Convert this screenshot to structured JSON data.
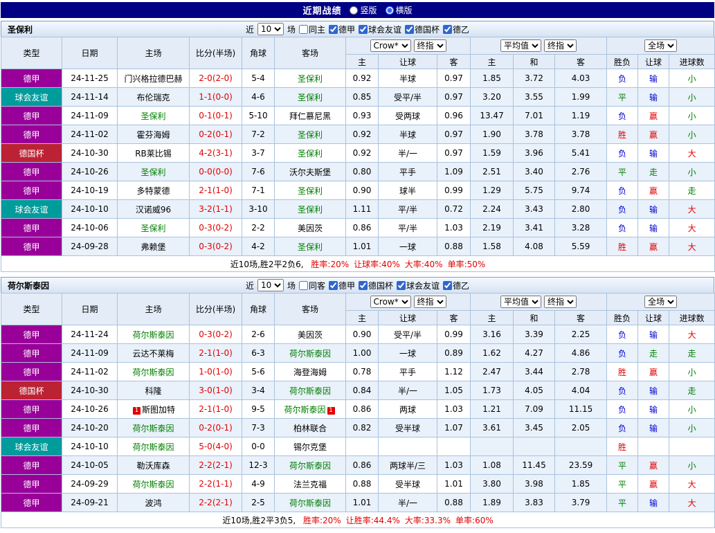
{
  "topbar": {
    "title": "近期战绩",
    "vertical_label": "竖版",
    "horizontal_label": "横版",
    "selected": "横版"
  },
  "colors": {
    "topbar_bg": "#000085",
    "type_bg": {
      "德甲": "#990099",
      "球会友谊": "#009b9b",
      "德国杯": "#bb2233"
    },
    "result_text": {
      "胜": "#e10000",
      "平": "#008000",
      "负": "#0000d0",
      "赢": "#e10000",
      "输": "#0000d0",
      "走": "#008000",
      "大": "#e10000",
      "小": "#008000"
    },
    "score_text": "#e10000",
    "subject_team_text": "#008000",
    "footer_stat_text": "#e10000",
    "redcard_bg": "#e10000"
  },
  "table_header": {
    "static_cols": [
      "类型",
      "日期",
      "主场",
      "比分(半场)",
      "角球",
      "客场"
    ],
    "groups": [
      {
        "selects": [
          "Crow*",
          "终指"
        ],
        "cols": [
          "主",
          "让球",
          "客"
        ],
        "avg": false
      },
      {
        "selects": [
          "平均值",
          "终指"
        ],
        "cols": [
          "主",
          "和",
          "客"
        ],
        "avg": true
      },
      {
        "selects": [
          "全场"
        ],
        "cols": [
          "胜负",
          "让球",
          "进球数"
        ],
        "avg": false
      }
    ]
  },
  "sections": [
    {
      "team": "圣保利",
      "filters": {
        "near_label": "近",
        "count": "10",
        "unit_label": "场",
        "same_label": "同主",
        "same_checked": false,
        "leagues": [
          "德甲",
          "球会友谊",
          "德国杯",
          "德乙"
        ]
      },
      "rows": [
        {
          "type": "德甲",
          "date": "24-11-25",
          "home": "门兴格拉德巴赫",
          "score": "2-0(2-0)",
          "corners": "5-4",
          "away": "圣保利",
          "away_subject": true,
          "odds": [
            "0.92",
            "半球",
            "0.97"
          ],
          "avg": [
            "1.85",
            "3.72",
            "4.03"
          ],
          "results": [
            "负",
            "输",
            "小"
          ]
        },
        {
          "type": "球会友谊",
          "date": "24-11-14",
          "home": "布伦瑞克",
          "score": "1-1(0-0)",
          "corners": "4-6",
          "away": "圣保利",
          "away_subject": true,
          "odds": [
            "0.85",
            "受平/半",
            "0.97"
          ],
          "avg": [
            "3.20",
            "3.55",
            "1.99"
          ],
          "results": [
            "平",
            "输",
            "小"
          ]
        },
        {
          "type": "德甲",
          "date": "24-11-09",
          "home": "圣保利",
          "home_subject": true,
          "score": "0-1(0-1)",
          "corners": "5-10",
          "away": "拜仁慕尼黑",
          "odds": [
            "0.93",
            "受两球",
            "0.96"
          ],
          "avg": [
            "13.47",
            "7.01",
            "1.19"
          ],
          "results": [
            "负",
            "赢",
            "小"
          ]
        },
        {
          "type": "德甲",
          "date": "24-11-02",
          "home": "霍芬海姆",
          "score": "0-2(0-1)",
          "corners": "7-2",
          "away": "圣保利",
          "away_subject": true,
          "odds": [
            "0.92",
            "半球",
            "0.97"
          ],
          "avg": [
            "1.90",
            "3.78",
            "3.78"
          ],
          "results": [
            "胜",
            "赢",
            "小"
          ]
        },
        {
          "type": "德国杯",
          "date": "24-10-30",
          "home": "RB莱比锡",
          "score": "4-2(3-1)",
          "corners": "3-7",
          "away": "圣保利",
          "away_subject": true,
          "odds": [
            "0.92",
            "半/一",
            "0.97"
          ],
          "avg": [
            "1.59",
            "3.96",
            "5.41"
          ],
          "results": [
            "负",
            "输",
            "大"
          ]
        },
        {
          "type": "德甲",
          "date": "24-10-26",
          "home": "圣保利",
          "home_subject": true,
          "score": "0-0(0-0)",
          "corners": "7-6",
          "away": "沃尔夫斯堡",
          "odds": [
            "0.80",
            "平手",
            "1.09"
          ],
          "avg": [
            "2.51",
            "3.40",
            "2.76"
          ],
          "results": [
            "平",
            "走",
            "小"
          ]
        },
        {
          "type": "德甲",
          "date": "24-10-19",
          "home": "多特蒙德",
          "score": "2-1(1-0)",
          "corners": "7-1",
          "away": "圣保利",
          "away_subject": true,
          "odds": [
            "0.90",
            "球半",
            "0.99"
          ],
          "avg": [
            "1.29",
            "5.75",
            "9.74"
          ],
          "results": [
            "负",
            "赢",
            "走"
          ]
        },
        {
          "type": "球会友谊",
          "date": "24-10-10",
          "home": "汉诺威96",
          "score": "3-2(1-1)",
          "corners": "3-10",
          "away": "圣保利",
          "away_subject": true,
          "odds": [
            "1.11",
            "平/半",
            "0.72"
          ],
          "avg": [
            "2.24",
            "3.43",
            "2.80"
          ],
          "results": [
            "负",
            "输",
            "大"
          ]
        },
        {
          "type": "德甲",
          "date": "24-10-06",
          "home": "圣保利",
          "home_subject": true,
          "score": "0-3(0-2)",
          "corners": "2-2",
          "away": "美因茨",
          "odds": [
            "0.86",
            "平/半",
            "1.03"
          ],
          "avg": [
            "2.19",
            "3.41",
            "3.28"
          ],
          "results": [
            "负",
            "输",
            "大"
          ]
        },
        {
          "type": "德甲",
          "date": "24-09-28",
          "home": "弗赖堡",
          "score": "0-3(0-2)",
          "corners": "4-2",
          "away": "圣保利",
          "away_subject": true,
          "odds": [
            "1.01",
            "一球",
            "0.88"
          ],
          "avg": [
            "1.58",
            "4.08",
            "5.59"
          ],
          "results": [
            "胜",
            "赢",
            "大"
          ]
        }
      ],
      "footer": {
        "prefix": "近10场,胜2平2负6, ",
        "stats": [
          "胜率:20%",
          "让球率:40%",
          "大率:40%",
          "单率:50%"
        ]
      }
    },
    {
      "team": "荷尔斯泰因",
      "filters": {
        "near_label": "近",
        "count": "10",
        "unit_label": "场",
        "same_label": "同客",
        "same_checked": false,
        "leagues": [
          "德甲",
          "德国杯",
          "球会友谊",
          "德乙"
        ]
      },
      "rows": [
        {
          "type": "德甲",
          "date": "24-11-24",
          "home": "荷尔斯泰因",
          "home_subject": true,
          "score": "0-3(0-2)",
          "corners": "2-6",
          "away": "美因茨",
          "odds": [
            "0.90",
            "受平/半",
            "0.99"
          ],
          "avg": [
            "3.16",
            "3.39",
            "2.25"
          ],
          "results": [
            "负",
            "输",
            "大"
          ]
        },
        {
          "type": "德甲",
          "date": "24-11-09",
          "home": "云达不莱梅",
          "score": "2-1(1-0)",
          "corners": "6-3",
          "away": "荷尔斯泰因",
          "away_subject": true,
          "odds": [
            "1.00",
            "一球",
            "0.89"
          ],
          "avg": [
            "1.62",
            "4.27",
            "4.86"
          ],
          "results": [
            "负",
            "走",
            "走"
          ]
        },
        {
          "type": "德甲",
          "date": "24-11-02",
          "home": "荷尔斯泰因",
          "home_subject": true,
          "score": "1-0(1-0)",
          "corners": "5-6",
          "away": "海登海姆",
          "odds": [
            "0.78",
            "平手",
            "1.12"
          ],
          "avg": [
            "2.47",
            "3.44",
            "2.78"
          ],
          "results": [
            "胜",
            "赢",
            "小"
          ]
        },
        {
          "type": "德国杯",
          "date": "24-10-30",
          "home": "科隆",
          "score": "3-0(1-0)",
          "corners": "3-4",
          "away": "荷尔斯泰因",
          "away_subject": true,
          "odds": [
            "0.84",
            "半/一",
            "1.05"
          ],
          "avg": [
            "1.73",
            "4.05",
            "4.04"
          ],
          "results": [
            "负",
            "输",
            "走"
          ]
        },
        {
          "type": "德甲",
          "date": "24-10-26",
          "home": "斯图加特",
          "home_redcards": 1,
          "score": "2-1(1-0)",
          "corners": "9-5",
          "away": "荷尔斯泰因",
          "away_subject": true,
          "away_redcards": 1,
          "odds": [
            "0.86",
            "两球",
            "1.03"
          ],
          "avg": [
            "1.21",
            "7.09",
            "11.15"
          ],
          "results": [
            "负",
            "输",
            "小"
          ]
        },
        {
          "type": "德甲",
          "date": "24-10-20",
          "home": "荷尔斯泰因",
          "home_subject": true,
          "score": "0-2(0-1)",
          "corners": "7-3",
          "away": "柏林联合",
          "odds": [
            "0.82",
            "受半球",
            "1.07"
          ],
          "avg": [
            "3.61",
            "3.45",
            "2.05"
          ],
          "results": [
            "负",
            "输",
            "小"
          ]
        },
        {
          "type": "球会友谊",
          "date": "24-10-10",
          "home": "荷尔斯泰因",
          "home_subject": true,
          "score": "5-0(4-0)",
          "corners": "0-0",
          "away": "锡尔克堡",
          "odds": [
            "",
            "",
            ""
          ],
          "avg": [
            "",
            "",
            ""
          ],
          "results": [
            "胜",
            "",
            ""
          ]
        },
        {
          "type": "德甲",
          "date": "24-10-05",
          "home": "勒沃库森",
          "score": "2-2(2-1)",
          "corners": "12-3",
          "away": "荷尔斯泰因",
          "away_subject": true,
          "odds": [
            "0.86",
            "两球半/三",
            "1.03"
          ],
          "avg": [
            "1.08",
            "11.45",
            "23.59"
          ],
          "results": [
            "平",
            "赢",
            "小"
          ]
        },
        {
          "type": "德甲",
          "date": "24-09-29",
          "home": "荷尔斯泰因",
          "home_subject": true,
          "score": "2-2(1-1)",
          "corners": "4-9",
          "away": "法兰克福",
          "odds": [
            "0.88",
            "受半球",
            "1.01"
          ],
          "avg": [
            "3.80",
            "3.98",
            "1.85"
          ],
          "results": [
            "平",
            "赢",
            "大"
          ]
        },
        {
          "type": "德甲",
          "date": "24-09-21",
          "home": "波鸿",
          "score": "2-2(2-1)",
          "corners": "2-5",
          "away": "荷尔斯泰因",
          "away_subject": true,
          "odds": [
            "1.01",
            "半/一",
            "0.88"
          ],
          "avg": [
            "1.89",
            "3.83",
            "3.79"
          ],
          "results": [
            "平",
            "输",
            "大"
          ]
        }
      ],
      "footer": {
        "prefix": "近10场,胜2平3负5, ",
        "stats": [
          "胜率:20%",
          "让胜率:44.4%",
          "大率:33.3%",
          "单率:60%"
        ]
      }
    }
  ]
}
